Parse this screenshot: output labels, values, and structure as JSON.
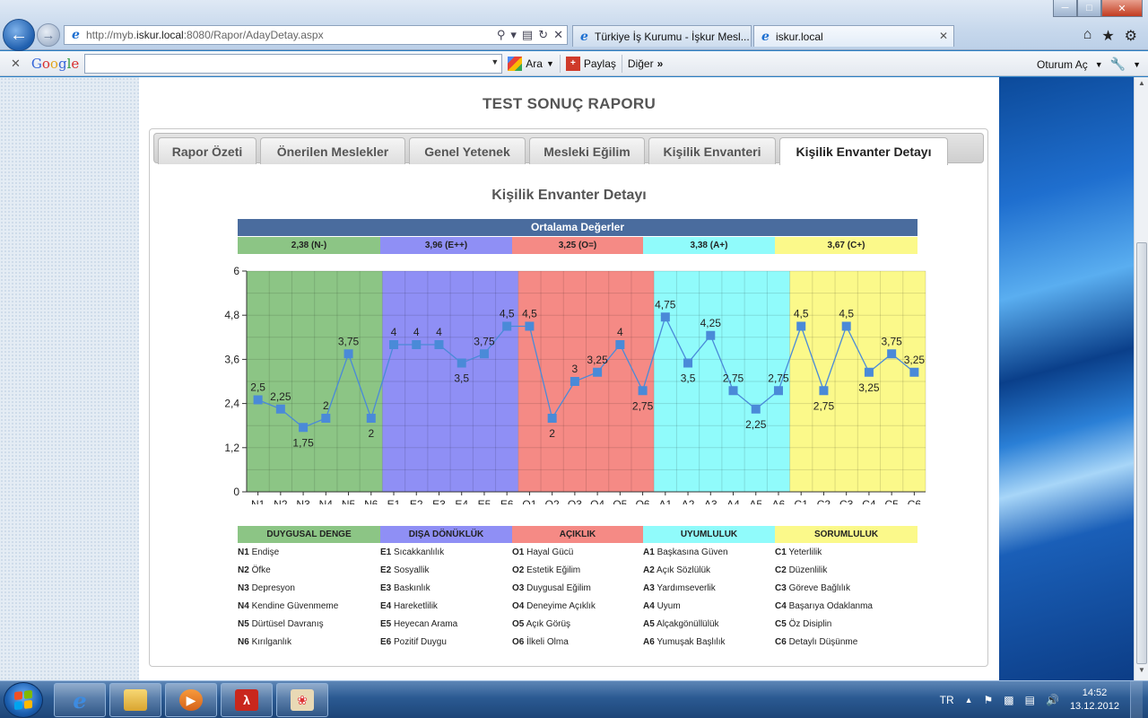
{
  "browser": {
    "address_url_prefix": "http://myb.",
    "address_url_host": "iskur.local",
    "address_url_suffix": ":8080/Rapor/AdayDetay.aspx",
    "tabs": [
      {
        "label": "Türkiye İş Kurumu - İşkur Mesl...",
        "active": false
      },
      {
        "label": "iskur.local",
        "active": true
      }
    ]
  },
  "google_toolbar": {
    "logo": [
      "G",
      "o",
      "o",
      "g",
      "l",
      "e"
    ],
    "search_value": "",
    "search_button": "Ara",
    "share_button": "Paylaş",
    "more_button": "Diğer",
    "signin": "Oturum Aç"
  },
  "page": {
    "title": "TEST SONUÇ RAPORU",
    "tabs": [
      "Rapor Özeti",
      "Önerilen Meslekler",
      "Genel Yetenek",
      "Mesleki Eğilim",
      "Kişilik Envanteri",
      "Kişilik Envanter Detayı"
    ],
    "active_tab": 5,
    "section_title": "Kişilik Envanter Detayı",
    "averages_title": "Ortalama Değerler",
    "averages": [
      {
        "label": "2,38 (N-)",
        "color": "#8cc585"
      },
      {
        "label": "3,96 (E++)",
        "color": "#8f8ff5"
      },
      {
        "label": "3,25 (O=)",
        "color": "#f58a85"
      },
      {
        "label": "3,38 (A+)",
        "color": "#90fbfb"
      },
      {
        "label": "3,67 (C+)",
        "color": "#fbf98a"
      }
    ]
  },
  "chart_data": {
    "type": "line",
    "categories": [
      "N1",
      "N2",
      "N3",
      "N4",
      "N5",
      "N6",
      "E1",
      "E2",
      "E3",
      "E4",
      "E5",
      "E6",
      "O1",
      "O2",
      "O3",
      "O4",
      "O5",
      "O6",
      "A1",
      "A2",
      "A3",
      "A4",
      "A5",
      "A6",
      "C1",
      "C2",
      "C3",
      "C4",
      "C5",
      "C6"
    ],
    "values": [
      2.5,
      2.25,
      1.75,
      2,
      3.75,
      2,
      4,
      4,
      4,
      3.5,
      3.75,
      4.5,
      4.5,
      2,
      3,
      3.25,
      4,
      2.75,
      4.75,
      3.5,
      4.25,
      2.75,
      2.25,
      2.75,
      4.5,
      2.75,
      4.5,
      3.25,
      3.75,
      3.25
    ],
    "value_labels": [
      "2,5",
      "2,25",
      "1,75",
      "2",
      "3,75",
      "2",
      "4",
      "4",
      "4",
      "3,5",
      "3,75",
      "4,5",
      "4,5",
      "2",
      "3",
      "3,25",
      "4",
      "2,75",
      "4,75",
      "3,5",
      "4,25",
      "2,75",
      "2,25",
      "2,75",
      "4,5",
      "2,75",
      "4,5",
      "3,25",
      "3,75",
      "3,25"
    ],
    "ylim": [
      0,
      6
    ],
    "yticks": [
      "0",
      "1,2",
      "2,4",
      "3,6",
      "4,8",
      "6"
    ],
    "band_colors": [
      "#8cc585",
      "#8f8ff5",
      "#f58a85",
      "#90fbfb",
      "#fbf98a"
    ],
    "line_color": "#4a8ad8",
    "grid": true
  },
  "legend": {
    "groups": [
      {
        "title": "DUYGUSAL DENGE",
        "color": "#8cc585",
        "items": [
          {
            "code": "N1",
            "text": "Endişe"
          },
          {
            "code": "N2",
            "text": "Öfke"
          },
          {
            "code": "N3",
            "text": "Depresyon"
          },
          {
            "code": "N4",
            "text": "Kendine Güvenmeme"
          },
          {
            "code": "N5",
            "text": "Dürtüsel Davranış"
          },
          {
            "code": "N6",
            "text": "Kırılganlık"
          }
        ]
      },
      {
        "title": "DIŞA DÖNÜKLÜK",
        "color": "#8f8ff5",
        "items": [
          {
            "code": "E1",
            "text": "Sıcakkanlılık"
          },
          {
            "code": "E2",
            "text": "Sosyallik"
          },
          {
            "code": "E3",
            "text": "Baskınlık"
          },
          {
            "code": "E4",
            "text": "Hareketlilik"
          },
          {
            "code": "E5",
            "text": "Heyecan Arama"
          },
          {
            "code": "E6",
            "text": "Pozitif Duygu"
          }
        ]
      },
      {
        "title": "AÇIKLIK",
        "color": "#f58a85",
        "items": [
          {
            "code": "O1",
            "text": "Hayal Gücü"
          },
          {
            "code": "O2",
            "text": "Estetik Eğilim"
          },
          {
            "code": "O3",
            "text": "Duygusal Eğilim"
          },
          {
            "code": "O4",
            "text": "Deneyime Açıklık"
          },
          {
            "code": "O5",
            "text": "Açık Görüş"
          },
          {
            "code": "O6",
            "text": "İlkeli Olma"
          }
        ]
      },
      {
        "title": "UYUMLULUK",
        "color": "#90fbfb",
        "items": [
          {
            "code": "A1",
            "text": "Başkasına Güven"
          },
          {
            "code": "A2",
            "text": "Açık Sözlülük"
          },
          {
            "code": "A3",
            "text": "Yardımseverlik"
          },
          {
            "code": "A4",
            "text": "Uyum"
          },
          {
            "code": "A5",
            "text": "Alçakgönüllülük"
          },
          {
            "code": "A6",
            "text": "Yumuşak Başlılık"
          }
        ]
      },
      {
        "title": "SORUMLULUK",
        "color": "#fbf98a",
        "items": [
          {
            "code": "C1",
            "text": "Yeterlilik"
          },
          {
            "code": "C2",
            "text": "Düzenlilik"
          },
          {
            "code": "C3",
            "text": "Göreve Bağlılık"
          },
          {
            "code": "C4",
            "text": "Başarıya Odaklanma"
          },
          {
            "code": "C5",
            "text": "Öz Disiplin"
          },
          {
            "code": "C6",
            "text": "Detaylı Düşünme"
          }
        ]
      }
    ]
  },
  "taskbar": {
    "language": "TR",
    "time": "14:52",
    "date": "13.12.2012"
  }
}
